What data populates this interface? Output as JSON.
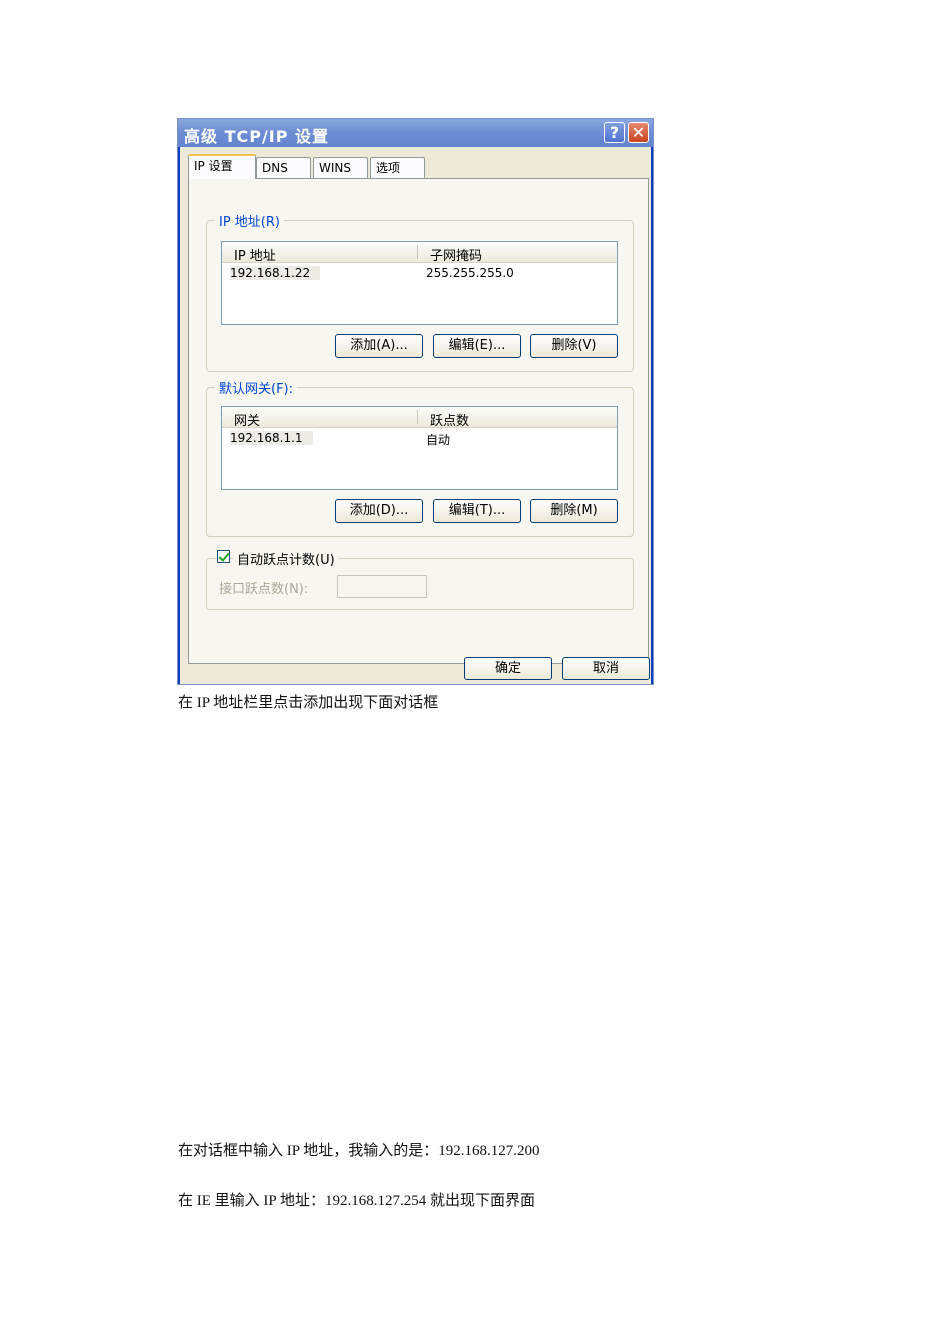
{
  "dialog": {
    "title": "高级 TCP/IP 设置",
    "help_glyph": "?",
    "close_glyph": "✕",
    "tabs": [
      {
        "label": "IP 设置"
      },
      {
        "label": "DNS"
      },
      {
        "label": "WINS"
      },
      {
        "label": "选项"
      }
    ],
    "ip_group": {
      "legend": "IP 地址(R)",
      "columns": [
        "IP 地址",
        "子网掩码"
      ],
      "rows": [
        [
          "192.168.1.22",
          "255.255.255.0"
        ]
      ],
      "buttons": {
        "add": "添加(A)...",
        "edit": "编辑(E)...",
        "delete": "删除(V)"
      }
    },
    "gateway_group": {
      "legend": "默认网关(F):",
      "columns": [
        "网关",
        "跃点数"
      ],
      "rows": [
        [
          "192.168.1.1",
          "自动"
        ]
      ],
      "buttons": {
        "add": "添加(D)...",
        "edit": "编辑(T)...",
        "delete": "删除(M)"
      }
    },
    "metric_group": {
      "checkbox_label": "自动跃点计数(U)",
      "checked": true,
      "interface_metric_label": "接口跃点数(N):",
      "interface_metric_value": ""
    },
    "footer": {
      "ok": "确定",
      "cancel": "取消"
    }
  },
  "doc": {
    "caption1": "在 IP 地址栏里点击添加出现下面对话框",
    "caption2": "在对话框中输入 IP 地址，我输入的是：192.168.127.200",
    "caption3": "在 IE 里输入 IP 地址：192.168.127.254  就出现下面界面"
  }
}
